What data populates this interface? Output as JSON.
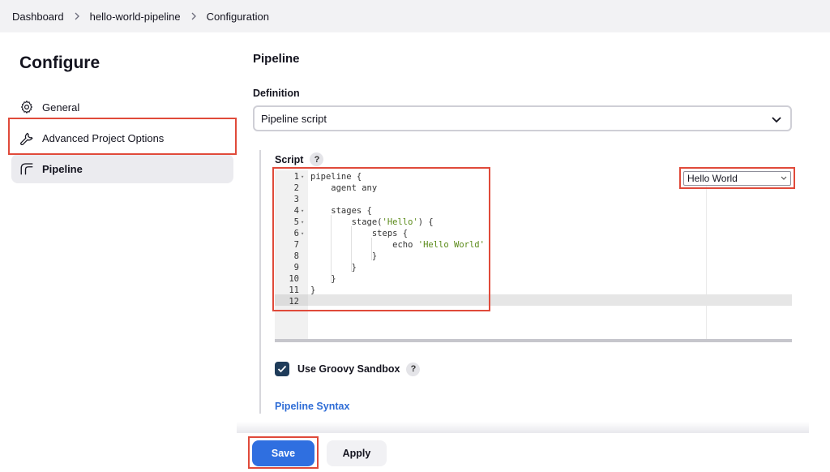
{
  "breadcrumb": {
    "items": [
      "Dashboard",
      "hello-world-pipeline",
      "Configuration"
    ]
  },
  "sidebar": {
    "title": "Configure",
    "items": [
      {
        "label": "General",
        "icon": "gear-icon"
      },
      {
        "label": "Advanced Project Options",
        "icon": "wrench-icon"
      },
      {
        "label": "Pipeline",
        "icon": "pipeline-icon",
        "active": true
      }
    ]
  },
  "main": {
    "section_title": "Pipeline",
    "definition_label": "Definition",
    "definition_value": "Pipeline script",
    "script_label": "Script",
    "help_glyph": "?",
    "sample_select_value": "Hello World",
    "code_lines": [
      {
        "n": "1",
        "fold": true,
        "text": "pipeline {"
      },
      {
        "n": "2",
        "fold": false,
        "text": "    agent any"
      },
      {
        "n": "3",
        "fold": false,
        "text": ""
      },
      {
        "n": "4",
        "fold": true,
        "text": "    stages {"
      },
      {
        "n": "5",
        "fold": true,
        "pre": "        stage(",
        "str": "'Hello'",
        "post": ") {"
      },
      {
        "n": "6",
        "fold": true,
        "text": "            steps {"
      },
      {
        "n": "7",
        "fold": false,
        "pre": "                echo ",
        "str": "'Hello World'",
        "post": ""
      },
      {
        "n": "8",
        "fold": false,
        "text": "            }"
      },
      {
        "n": "9",
        "fold": false,
        "text": "        }"
      },
      {
        "n": "10",
        "fold": false,
        "text": "    }"
      },
      {
        "n": "11",
        "fold": false,
        "text": "}"
      },
      {
        "n": "12",
        "fold": false,
        "text": ""
      }
    ],
    "sandbox_label": "Use Groovy Sandbox",
    "sandbox_checked": true,
    "syntax_link": "Pipeline Syntax"
  },
  "actions": {
    "save_label": "Save",
    "apply_label": "Apply"
  },
  "colors": {
    "primary": "#2f6fe0",
    "highlight": "#e04a3a",
    "checkbox": "#1f3c5a",
    "link": "#2f6dd6",
    "string": "#5a8a18"
  }
}
